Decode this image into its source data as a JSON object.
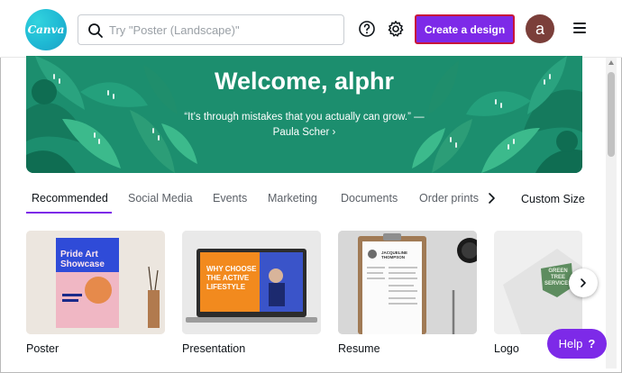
{
  "header": {
    "logo_text": "Canva",
    "search_placeholder": "Try \"Poster (Landscape)\"",
    "create_button": "Create a design",
    "avatar_initial": "a"
  },
  "banner": {
    "title": "Welcome, alphr",
    "quote": "“It’s through mistakes that you actually can grow.” —",
    "author": "Paula Scher ›"
  },
  "tabs": [
    {
      "label": "Recommended",
      "active": true
    },
    {
      "label": "Social Media"
    },
    {
      "label": "Events"
    },
    {
      "label": "Marketing"
    },
    {
      "label": "Documents"
    },
    {
      "label": "Order prints"
    }
  ],
  "custom_size": "Custom Size",
  "cards": [
    {
      "label": "Poster",
      "thumb_text": "Pride Art Showcase"
    },
    {
      "label": "Presentation",
      "thumb_text": "WHY CHOOSE THE ACTIVE LIFESTYLE"
    },
    {
      "label": "Resume",
      "thumb_text": "JACQUELINE THOMPSON"
    },
    {
      "label": "Logo",
      "thumb_text": "GREEN TREE SERVICES"
    }
  ],
  "help_label": "Help",
  "help_icon": "?",
  "colors": {
    "accent": "#7d2ae8",
    "banner": "#1c8e6e",
    "logo": "#20c4cb"
  },
  "icons": [
    "search-icon",
    "help-circle-icon",
    "gear-icon",
    "menu-icon",
    "chevron-right-icon"
  ]
}
